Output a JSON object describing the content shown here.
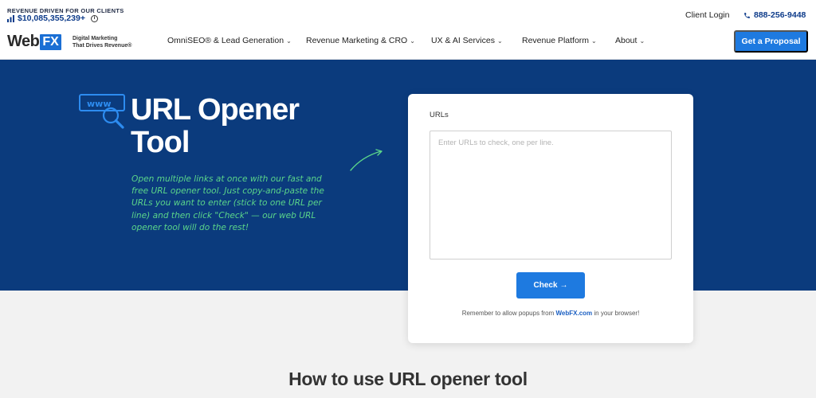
{
  "header": {
    "revenue_eyebrow": "REVENUE DRIVEN FOR OUR CLIENTS",
    "revenue_value": "$10,085,355,239+",
    "logo_web": "Web",
    "logo_fx": "FX",
    "tagline_line1": "Digital Marketing",
    "tagline_line2": "That Drives Revenue®",
    "client_login": "Client Login",
    "phone": "888-256-9448",
    "cta": "Get a Proposal"
  },
  "nav": [
    {
      "label": "OmniSEO® & Lead Generation"
    },
    {
      "label": "Revenue Marketing & CRO"
    },
    {
      "label": "UX & AI Services"
    },
    {
      "label": "Revenue Platform"
    },
    {
      "label": "About"
    }
  ],
  "hero": {
    "title_line1": "URL Opener",
    "title_line2": "Tool",
    "description": "Open multiple links at once with our fast and free URL opener tool. Just copy-and-paste the URLs you want to enter (stick to one URL per line) and then click \"Check\" — our web URL opener tool will do the rest!",
    "icon": "www-magnifier-icon"
  },
  "tool": {
    "label": "URLs",
    "placeholder": "Enter URLs to check, one per line.",
    "value": "",
    "check_label": "Check",
    "remember_prefix": "Remember to allow popups from ",
    "remember_link": "WebFX.com",
    "remember_suffix": " in your browser!"
  },
  "section": {
    "how_title": "How to use URL opener tool"
  },
  "colors": {
    "hero_bg": "#0b3b7d",
    "accent": "#1e7ae0",
    "desc_green": "#5bd68a"
  }
}
